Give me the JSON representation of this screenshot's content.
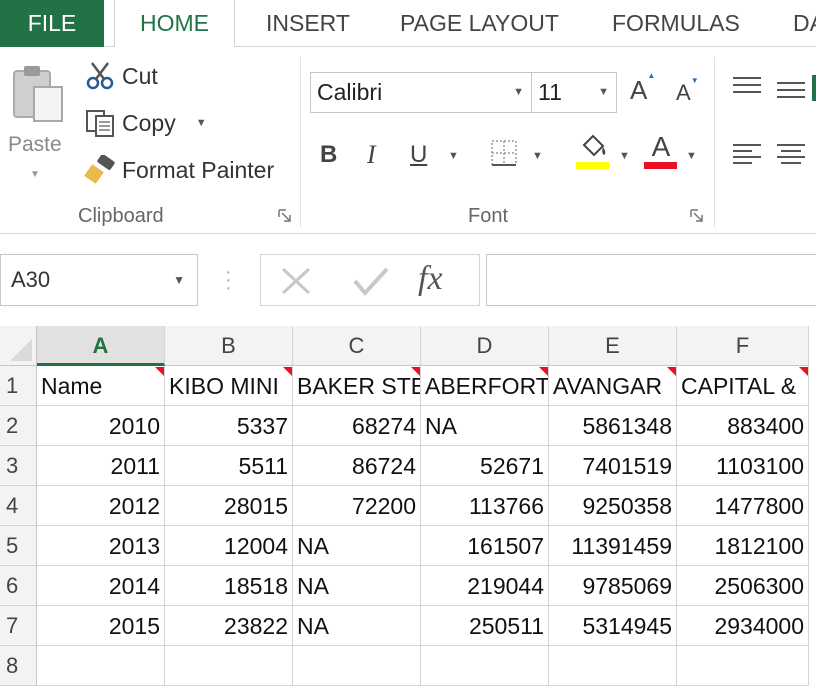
{
  "tabs": {
    "file": "FILE",
    "home": "HOME",
    "insert": "INSERT",
    "page_layout": "PAGE LAYOUT",
    "formulas": "FORMULAS",
    "data": "DA"
  },
  "clipboard": {
    "paste": "Paste",
    "cut": "Cut",
    "copy": "Copy",
    "format_painter": "Format Painter",
    "group_label": "Clipboard"
  },
  "font": {
    "family": "Calibri",
    "size": "11",
    "bold": "B",
    "italic": "I",
    "underline": "U",
    "grow": "A",
    "shrink": "A",
    "font_color": "A",
    "group_label": "Font",
    "highlight_color": "#ffff00",
    "text_color": "#e81123"
  },
  "formula_bar": {
    "name_box": "A30",
    "fx": "fx",
    "value": ""
  },
  "sheet": {
    "columns": [
      "A",
      "B",
      "C",
      "D",
      "E",
      "F"
    ],
    "selected_column": "A",
    "row_numbers": [
      "1",
      "2",
      "3",
      "4",
      "5",
      "6",
      "7",
      "8"
    ],
    "rows": [
      [
        "Name",
        "KIBO MINI",
        "BAKER STE",
        "ABERFORT",
        "AVANGAR",
        "CAPITAL &"
      ],
      [
        "2010",
        "5337",
        "68274",
        "NA",
        "5861348",
        "883400"
      ],
      [
        "2011",
        "5511",
        "86724",
        "52671",
        "7401519",
        "1103100"
      ],
      [
        "2012",
        "28015",
        "72200",
        "113766",
        "9250358",
        "1477800"
      ],
      [
        "2013",
        "12004",
        "NA",
        "161507",
        "11391459",
        "1812100"
      ],
      [
        "2014",
        "18518",
        "NA",
        "219044",
        "9785069",
        "2506300"
      ],
      [
        "2015",
        "23822",
        "NA",
        "250511",
        "5314945",
        "2934000"
      ],
      [
        "",
        "",
        "",
        "",
        "",
        ""
      ]
    ],
    "accent_color": "#217346"
  }
}
